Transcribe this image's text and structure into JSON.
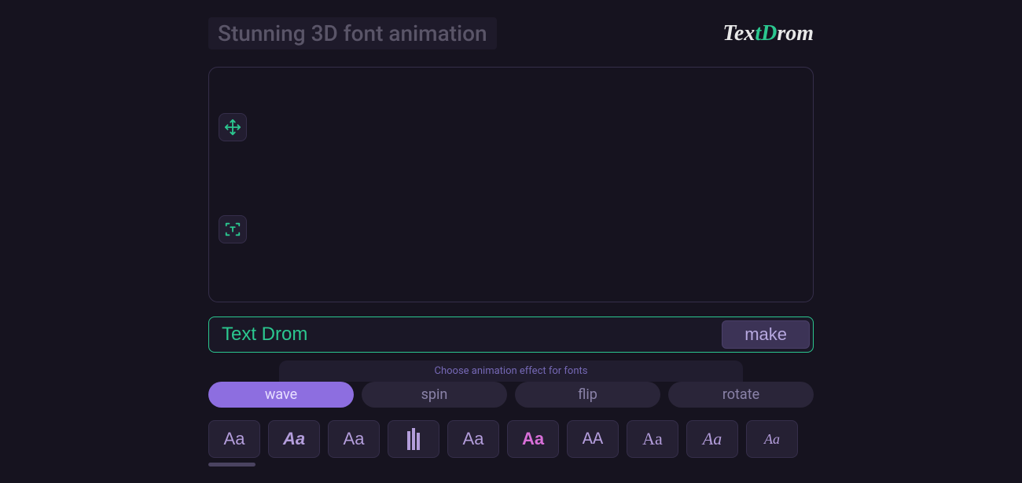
{
  "header": {
    "title": "Stunning 3D font animation",
    "logo_text": "TextDrom"
  },
  "canvas": {
    "tools": {
      "move_name": "move-tool",
      "text_name": "text-frame-tool"
    }
  },
  "input": {
    "value": "Text Drom",
    "make_label": "make"
  },
  "hint": {
    "text": "Choose animation effect for fonts"
  },
  "tabs": [
    {
      "label": "wave",
      "active": true
    },
    {
      "label": "spin",
      "active": false
    },
    {
      "label": "flip",
      "active": false
    },
    {
      "label": "rotate",
      "active": false
    }
  ],
  "fonts": [
    {
      "sample": "Aa",
      "name": "font-arial"
    },
    {
      "sample": "Aa",
      "name": "font-arial-black-italic"
    },
    {
      "sample": "Aa",
      "name": "font-trebuchet"
    },
    {
      "sample": "",
      "name": "font-book-icon"
    },
    {
      "sample": "Aa",
      "name": "font-verdana"
    },
    {
      "sample": "Aa",
      "name": "font-impact"
    },
    {
      "sample": "AA",
      "name": "font-smallcaps"
    },
    {
      "sample": "Aa",
      "name": "font-georgia"
    },
    {
      "sample": "Aa",
      "name": "font-script"
    },
    {
      "sample": "Aa",
      "name": "font-handwriting"
    }
  ]
}
